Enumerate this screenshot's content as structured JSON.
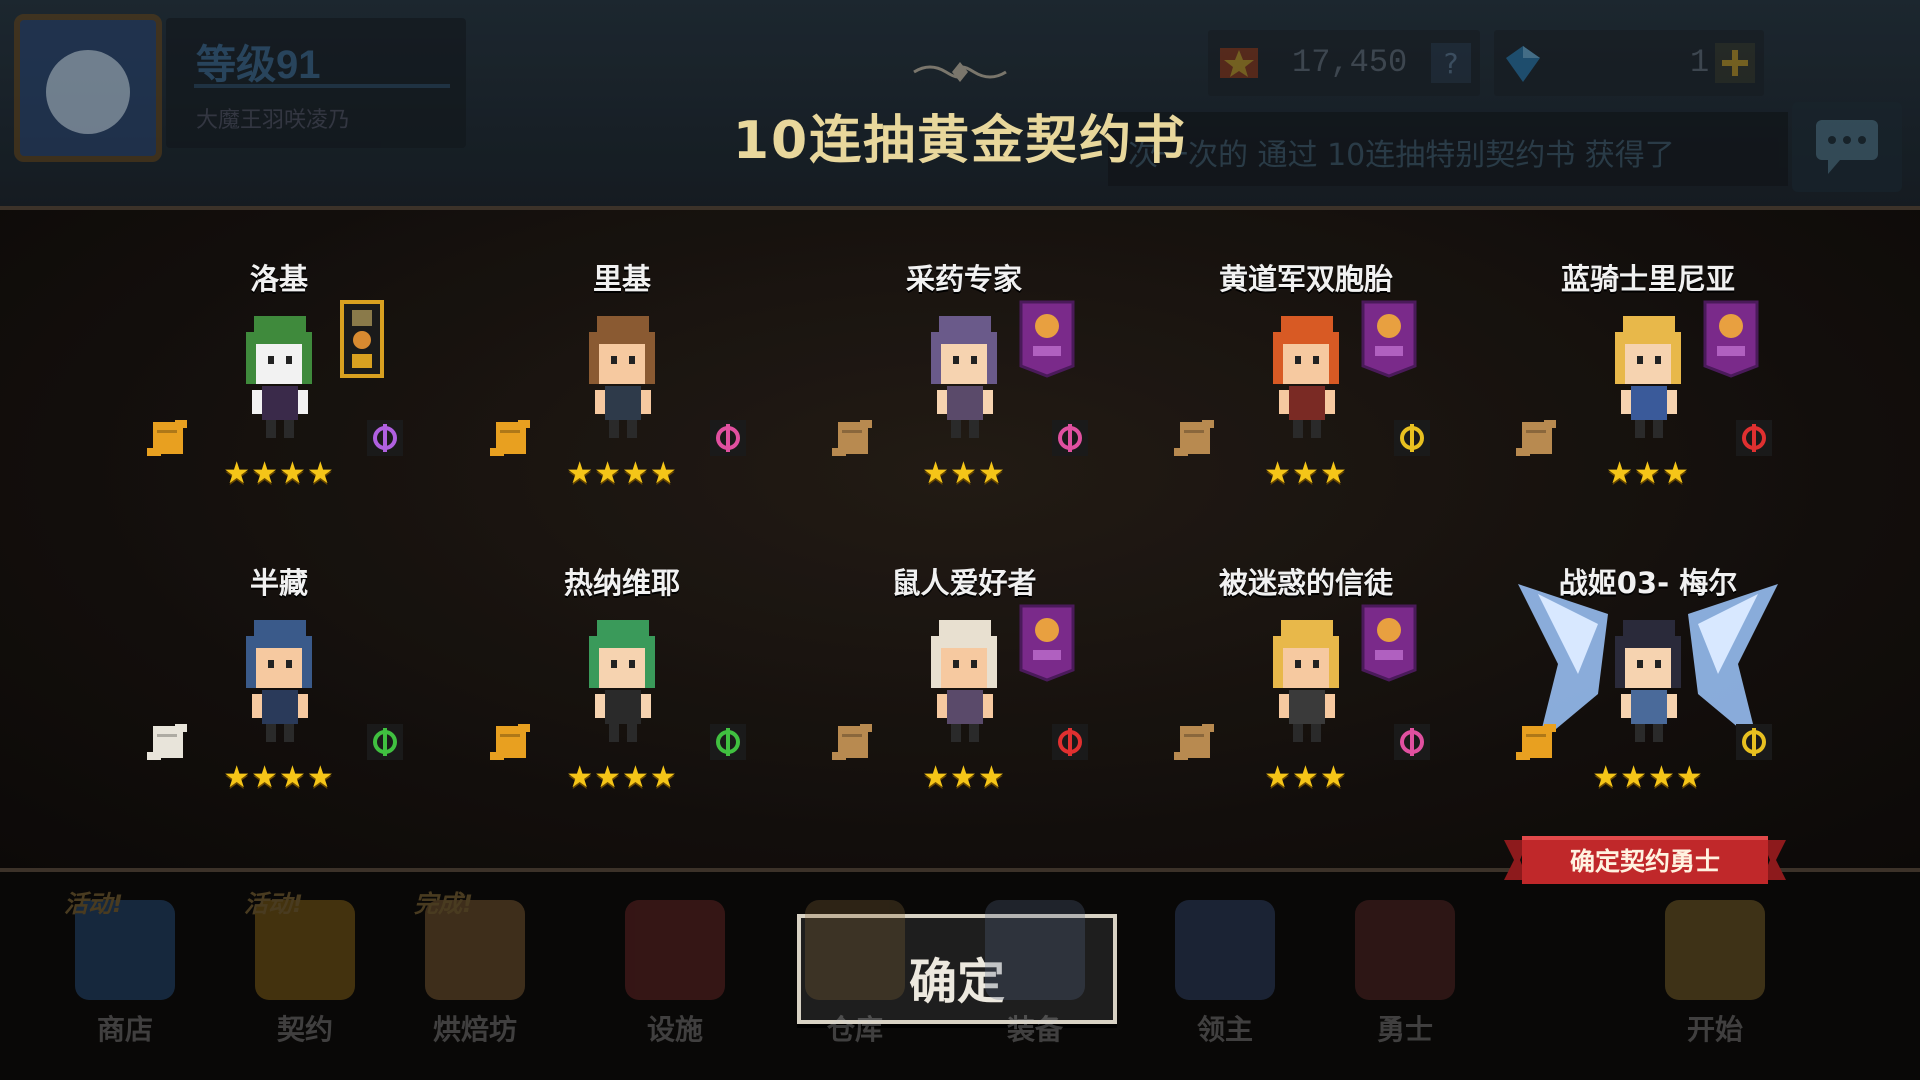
{
  "player": {
    "level": "等级91",
    "name": "大魔王羽咲凌乃"
  },
  "currency": {
    "gold": "17,450",
    "gems": "1"
  },
  "ticker": {
    "text": "次一次的 通过 10连抽特别契约书 获得了"
  },
  "dialog": {
    "title": "10连抽黄金契约书",
    "confirm_label": "确定",
    "featured_label": "确定契约勇士"
  },
  "heroes": [
    {
      "name": "洛基",
      "rarity": 4,
      "stars": "★★★★",
      "emblem": "black",
      "class": "purple-staff"
    },
    {
      "name": "里基",
      "rarity": 4,
      "stars": "★★★★",
      "emblem": "none",
      "class": "pink-gem"
    },
    {
      "name": "采药专家",
      "rarity": 3,
      "stars": "★★★",
      "emblem": "purple",
      "class": "pink-gem"
    },
    {
      "name": "黄道军双胞胎",
      "rarity": 3,
      "stars": "★★★",
      "emblem": "purple",
      "class": "yellow-sword"
    },
    {
      "name": "蓝骑士里尼亚",
      "rarity": 3,
      "stars": "★★★",
      "emblem": "purple",
      "class": "red-swords"
    },
    {
      "name": "半藏",
      "rarity": 4,
      "stars": "★★★★",
      "emblem": "none",
      "class": "green-shuriken"
    },
    {
      "name": "热纳维耶",
      "rarity": 4,
      "stars": "★★★★",
      "emblem": "none",
      "class": "green-shuriken"
    },
    {
      "name": "鼠人爱好者",
      "rarity": 3,
      "stars": "★★★",
      "emblem": "purple",
      "class": "red-swords"
    },
    {
      "name": "被迷惑的信徒",
      "rarity": 3,
      "stars": "★★★",
      "emblem": "purple",
      "class": "pink-gem"
    },
    {
      "name": "战姬03- 梅尔",
      "rarity": 4,
      "stars": "★★★★",
      "emblem": "none",
      "class": "yellow-sword"
    }
  ],
  "nav": [
    {
      "label": "商店",
      "tag": "活动!",
      "icon": "shop-icon"
    },
    {
      "label": "契约",
      "tag": "活动!",
      "icon": "contract-icon"
    },
    {
      "label": "烘焙坊",
      "tag": "完成!",
      "icon": "bakery-icon"
    },
    {
      "label": "设施",
      "tag": "",
      "icon": "facility-icon"
    },
    {
      "label": "仓库",
      "tag": "",
      "icon": "warehouse-icon"
    },
    {
      "label": "装备",
      "tag": "",
      "icon": "equipment-icon"
    },
    {
      "label": "领主",
      "tag": "",
      "icon": "lord-icon"
    },
    {
      "label": "勇士",
      "tag": "",
      "icon": "hero-icon"
    },
    {
      "label": "开始",
      "tag": "",
      "icon": "start-icon"
    }
  ],
  "colors": {
    "title": "#e8d79c",
    "star": "#f5c518",
    "ribbon": "#c0282a"
  }
}
